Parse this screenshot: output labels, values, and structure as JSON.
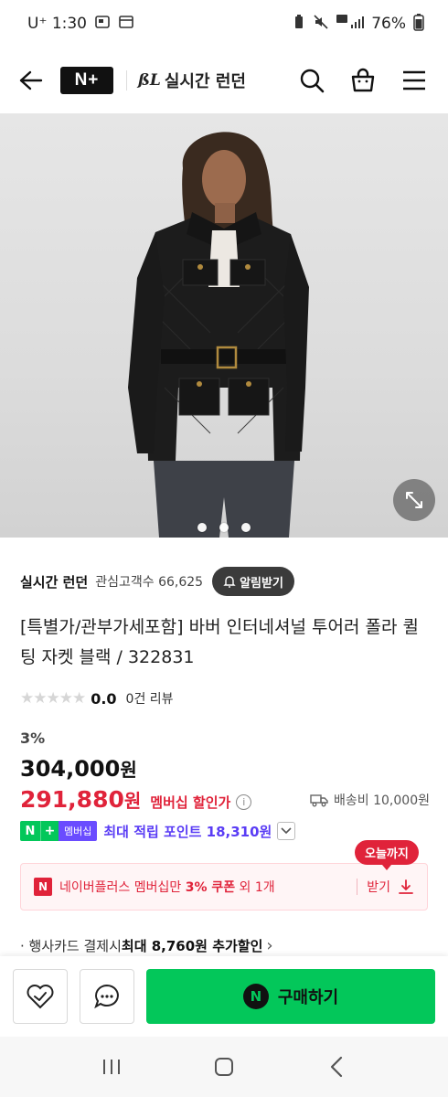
{
  "status_bar": {
    "carrier_time": "U⁺ 1:30",
    "battery": "76%"
  },
  "header": {
    "logo": "N+",
    "store_name": "실시간 런던",
    "store_mark": "ßL"
  },
  "gallery": {
    "dots": [
      true,
      false,
      false
    ],
    "image_description_icon": "product-photo"
  },
  "store": {
    "name": "실시간 런던",
    "followers": "관심고객수 66,625",
    "alert_label": "알림받기"
  },
  "product": {
    "title": "[특별가/관부가세포함] 바버 인터네셔널 투어러 폴라 퀼팅 자켓 블랙 / 322831",
    "rating": "0.0",
    "review_count": "0건 리뷰",
    "discount": "3%",
    "original_price": "304,000",
    "price_unit": "원",
    "member_price": "291,880",
    "member_label": "멤버십 할인가",
    "shipping": "배송비 10,000원"
  },
  "points": {
    "badge_n": "N",
    "badge_plus": "+",
    "badge_label": "멤버십",
    "text": "최대 적립 포인트 18,310원"
  },
  "coupon": {
    "badge": "오늘까지",
    "icon": "N",
    "text_prefix": "네이버플러스 멤버십만 ",
    "text_bold": "3% 쿠폰",
    "text_suffix": " 외 1개",
    "get_label": "받기"
  },
  "card_discount": {
    "prefix": "· 행사카드 결제시 ",
    "bold": "최대 8,760원 추가할인",
    "chevron": "›"
  },
  "action_bar": {
    "buy_icon": "N",
    "buy_label": "구매하기"
  },
  "colors": {
    "naver_green": "#03c75a",
    "price_red": "#e0233a",
    "membership_purple": "#5a3df5"
  }
}
